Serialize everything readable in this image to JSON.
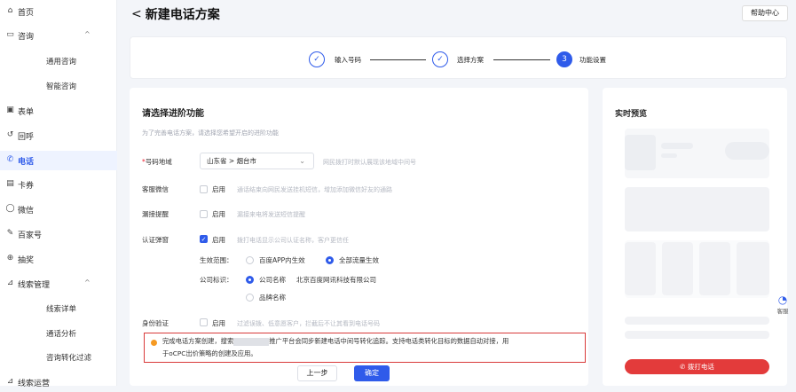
{
  "sidebar": {
    "items": [
      {
        "label": "首页",
        "icon": "home-icon",
        "glyph": "⌂"
      },
      {
        "label": "咨询",
        "icon": "chat-icon",
        "glyph": "▭",
        "caret": "^"
      },
      {
        "label": "通用咨询"
      },
      {
        "label": "智能咨询"
      },
      {
        "label": "表单",
        "icon": "form-icon",
        "glyph": "▣"
      },
      {
        "label": "回呼",
        "icon": "callback-icon",
        "glyph": "↺"
      },
      {
        "label": "电话",
        "icon": "phone-icon",
        "glyph": "✆"
      },
      {
        "label": "卡券",
        "icon": "coupon-icon",
        "glyph": "▤"
      },
      {
        "label": "微信",
        "icon": "wechat-icon",
        "glyph": "◯"
      },
      {
        "label": "百家号",
        "icon": "baijiahao-icon",
        "glyph": "✎"
      },
      {
        "label": "抽奖",
        "icon": "gift-icon",
        "glyph": "⊕"
      },
      {
        "label": "线索管理",
        "icon": "leads-icon",
        "glyph": "⊿",
        "caret": "^"
      },
      {
        "label": "线索详单"
      },
      {
        "label": "通话分析"
      },
      {
        "label": "咨询转化过滤"
      },
      {
        "label": "线索运营",
        "icon": "ops-icon",
        "glyph": "⊿"
      }
    ]
  },
  "header": {
    "back": "<",
    "title": "新建电话方案",
    "help": "帮助中心"
  },
  "steps": [
    {
      "label": "输入号码",
      "mark": "✓"
    },
    {
      "label": "选择方案",
      "mark": "✓"
    },
    {
      "label": "功能设置",
      "mark": "3"
    }
  ],
  "form": {
    "title": "请选择进阶功能",
    "subtitle": "为了完善电话方案，请选择您希望开启的进阶功能",
    "region": {
      "label": "号码地域",
      "required": "*",
      "value": "山东省 > 烟台市",
      "hint": "网民拨打时默认展现该地域中间号"
    },
    "wechat": {
      "label": "客服微信",
      "enable": "启用",
      "hint": "通话结束向网民发送挂机短信，增加添加微信好友的通路"
    },
    "missed": {
      "label": "漏接提醒",
      "enable": "启用",
      "hint": "漏接来电将发送短信提醒"
    },
    "auth": {
      "label": "认证弹窗",
      "enable": "启用",
      "hint": "拨打电话显示公司认证名称，客户更信任",
      "scope_label": "生效范围：",
      "scope_opt1": "百度APP内生效",
      "scope_opt2": "全部流量生效",
      "id_label": "公司标识：",
      "id_opt1": "公司名称",
      "company": "北京百度网讯科技有限公司",
      "id_opt2": "品牌名称"
    },
    "identity": {
      "label": "身份验证",
      "enable": "启用",
      "hint": "过滤误拨、低意愿客户，拦截后不让其看到电话号码"
    },
    "notice_a": "完成电话方案创建，搜索",
    "notice_b": "推广平台会同步新建电话中间号转化追踪。支持电话类转化目标的数据自动对接，用",
    "notice_c": "于oCPC出价策略的创建及应用。",
    "prev": "上一步",
    "ok": "确定"
  },
  "preview": {
    "title": "实时预览",
    "call": "✆ 拨打电话"
  },
  "kefu": {
    "label": "客服"
  },
  "colors": {
    "accent": "#2f5bea",
    "danger": "#e33b3b",
    "warn": "#f59a23"
  }
}
